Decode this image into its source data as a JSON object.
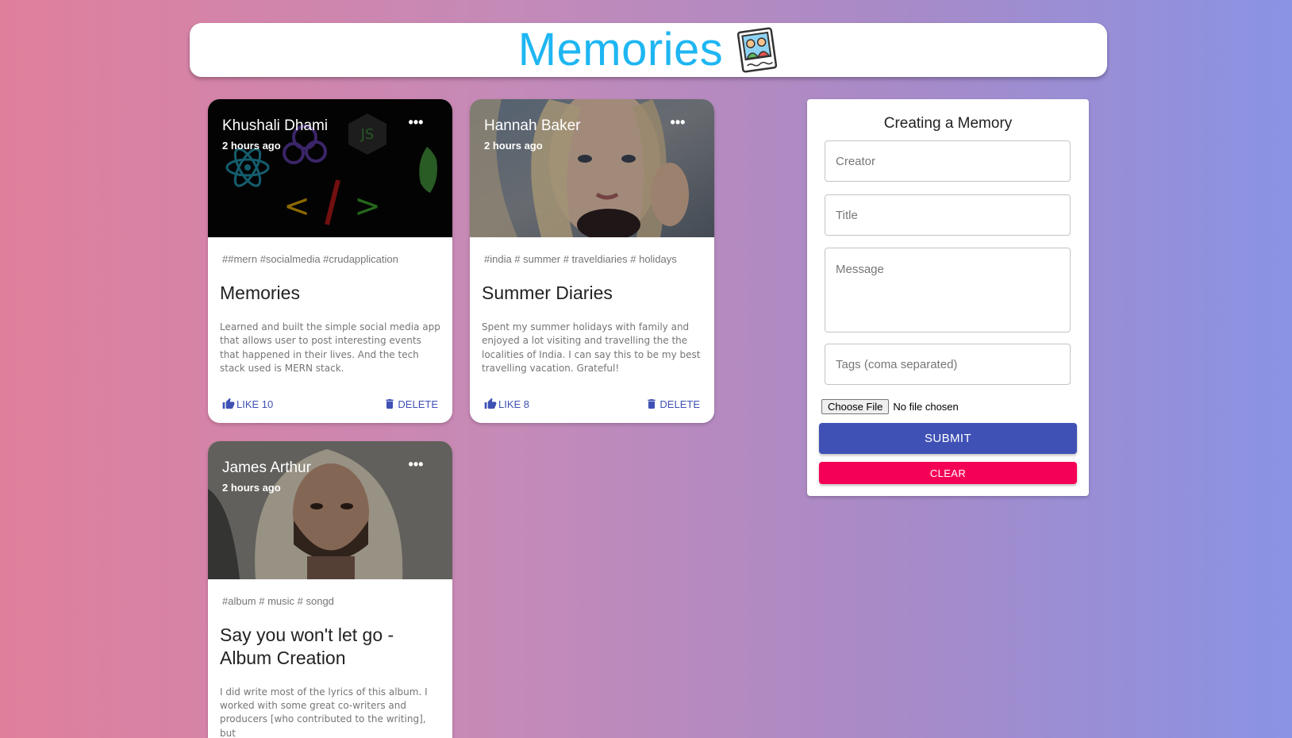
{
  "header": {
    "title": "Memories",
    "logo_icon": "polaroid-photo-icon"
  },
  "posts": [
    {
      "creator": "Khushali Dhami",
      "time": "2 hours ago",
      "tags": "##mern #socialmedia #crudapplication",
      "title": "Memories",
      "message": "Learned and built the simple social media app that allows user to post interesting events that happened in their lives. And the tech stack used is MERN stack.",
      "like_label": "LIKE 10",
      "delete_label": "DELETE"
    },
    {
      "creator": "Hannah Baker",
      "time": "2 hours ago",
      "tags": "#india # summer # traveldiaries # holidays",
      "title": "Summer Diaries",
      "message": "Spent my summer holidays with family and enjoyed a lot visiting and travelling the the localities of India. I can say this to be my best travelling vacation. Grateful!",
      "like_label": "LIKE 8",
      "delete_label": "DELETE"
    },
    {
      "creator": "James Arthur",
      "time": "2 hours ago",
      "tags": "#album # music # songd",
      "title": "Say you won't let go - Album Creation",
      "message": "I did write most of the lyrics of this album. I worked with some great co-writers and producers [who contributed to the writing], but",
      "like_label": "",
      "delete_label": ""
    }
  ],
  "form": {
    "title": "Creating a Memory",
    "creator_placeholder": "Creator",
    "title_placeholder": "Title",
    "message_placeholder": "Message",
    "tags_placeholder": "Tags (coma separated)",
    "file_button": "Choose File",
    "file_status": "No file chosen",
    "submit_label": "SUBMIT",
    "clear_label": "CLEAR"
  },
  "colors": {
    "title_blue": "#1eb6f2",
    "primary": "#3f51b5",
    "secondary": "#f50057"
  }
}
